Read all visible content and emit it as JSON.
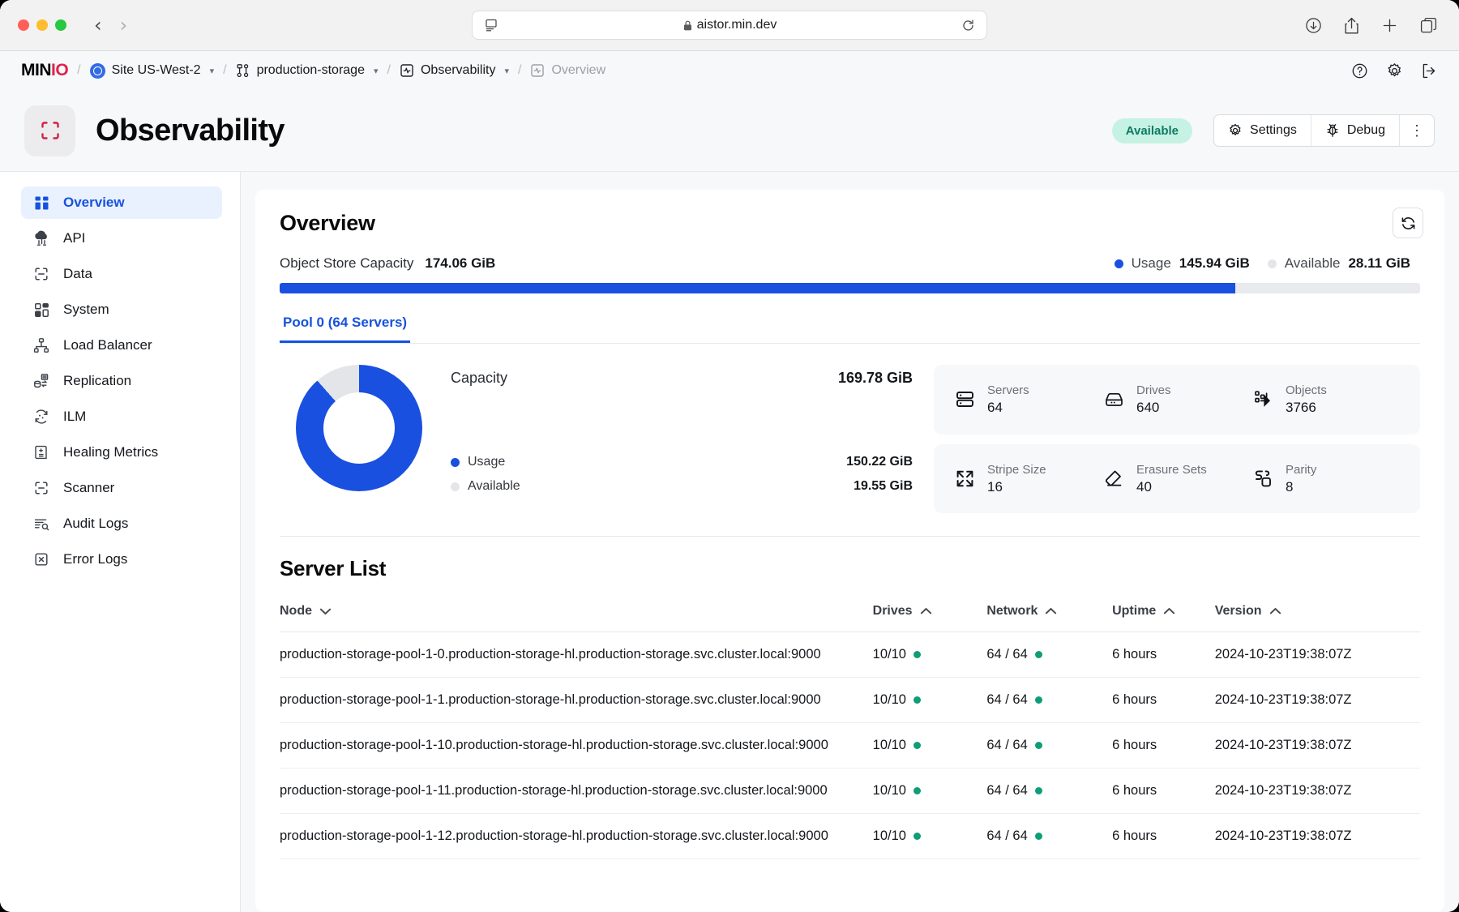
{
  "browser": {
    "url": "aistor.min.dev",
    "lock_icon": "lock-icon",
    "back_icon": "chevron-left-icon",
    "forward_icon": "chevron-right-icon",
    "sidebar_icon": "sidebar-toggle-icon",
    "reload_icon": "reload-icon",
    "downloads_icon": "downloads-icon",
    "share_icon": "share-icon",
    "newtab_icon": "plus-icon",
    "tabs_icon": "tab-overview-icon"
  },
  "topbar": {
    "logo_min": "MIN",
    "logo_io": "IO",
    "separator": "/",
    "breadcrumbs": [
      {
        "label": "Site US-West-2",
        "icon": "kubernetes-icon",
        "has_chevron": true,
        "dim": false
      },
      {
        "label": "production-storage",
        "icon": "tenant-icon",
        "has_chevron": true,
        "dim": false
      },
      {
        "label": "Observability",
        "icon": "observability-icon",
        "has_chevron": true,
        "dim": false
      },
      {
        "label": "Overview",
        "icon": "observability-icon",
        "has_chevron": false,
        "dim": true
      }
    ],
    "actions": [
      {
        "name": "help-icon"
      },
      {
        "name": "gear-icon"
      },
      {
        "name": "logout-icon"
      }
    ]
  },
  "header": {
    "icon": "scan-frame-icon",
    "title": "Observability",
    "status_badge": "Available",
    "settings_label": "Settings",
    "settings_icon": "gear-icon",
    "debug_label": "Debug",
    "debug_icon": "bug-icon",
    "kebab": "⋮"
  },
  "sidebar": {
    "items": [
      {
        "label": "Overview",
        "icon": "grid-icon",
        "active": true
      },
      {
        "label": "API",
        "icon": "cloud-api-icon",
        "active": false
      },
      {
        "label": "Data",
        "icon": "scan-minus-icon",
        "active": false
      },
      {
        "label": "System",
        "icon": "grid-icon",
        "active": false
      },
      {
        "label": "Load Balancer",
        "icon": "hierarchy-icon",
        "active": false
      },
      {
        "label": "Replication",
        "icon": "replication-icon",
        "active": false
      },
      {
        "label": "ILM",
        "icon": "lifecycle-icon",
        "active": false
      },
      {
        "label": "Healing Metrics",
        "icon": "healing-icon",
        "active": false
      },
      {
        "label": "Scanner",
        "icon": "scan-minus-icon",
        "active": false
      },
      {
        "label": "Audit Logs",
        "icon": "audit-log-icon",
        "active": false
      },
      {
        "label": "Error Logs",
        "icon": "error-log-icon",
        "active": false
      }
    ]
  },
  "overview": {
    "title": "Overview",
    "refresh_icon": "refresh-icon",
    "capacity_label": "Object Store Capacity",
    "capacity_value": "174.06 GiB",
    "legend": [
      {
        "name": "Usage",
        "value": "145.94 GiB",
        "color": "#1a50e0"
      },
      {
        "name": "Available",
        "value": "28.11 GiB",
        "color": "#e3e5e8"
      }
    ],
    "bar_fill_percent": 83.8,
    "tabs": [
      {
        "label": "Pool 0 (64 Servers)",
        "active": true
      }
    ],
    "pool": {
      "capacity_label": "Capacity",
      "capacity_value": "169.78 GiB",
      "usage_label": "Usage",
      "usage_value": "150.22 GiB",
      "available_label": "Available",
      "available_value": "19.55 GiB",
      "donut_usage_percent": 88.5
    },
    "stats": [
      [
        {
          "icon": "servers-icon",
          "label": "Servers",
          "value": "64"
        },
        {
          "icon": "drive-icon",
          "label": "Drives",
          "value": "640"
        },
        {
          "icon": "objects-icon",
          "label": "Objects",
          "value": "3766"
        }
      ],
      [
        {
          "icon": "stripe-size-icon",
          "label": "Stripe Size",
          "value": "16"
        },
        {
          "icon": "erasure-sets-icon",
          "label": "Erasure Sets",
          "value": "40"
        },
        {
          "icon": "parity-icon",
          "label": "Parity",
          "value": "8"
        }
      ]
    ]
  },
  "server_list": {
    "title": "Server List",
    "columns": [
      {
        "label": "Node",
        "sort": "down"
      },
      {
        "label": "Drives",
        "sort": "up"
      },
      {
        "label": "Network",
        "sort": "up"
      },
      {
        "label": "Uptime",
        "sort": "up"
      },
      {
        "label": "Version",
        "sort": "up"
      }
    ],
    "rows": [
      {
        "node": "production-storage-pool-1-0.production-storage-hl.production-storage.svc.cluster.local:9000",
        "drives": "10/10",
        "network": "64 / 64",
        "uptime": "6 hours",
        "version": "2024-10-23T19:38:07Z"
      },
      {
        "node": "production-storage-pool-1-1.production-storage-hl.production-storage.svc.cluster.local:9000",
        "drives": "10/10",
        "network": "64 / 64",
        "uptime": "6 hours",
        "version": "2024-10-23T19:38:07Z"
      },
      {
        "node": "production-storage-pool-1-10.production-storage-hl.production-storage.svc.cluster.local:9000",
        "drives": "10/10",
        "network": "64 / 64",
        "uptime": "6 hours",
        "version": "2024-10-23T19:38:07Z"
      },
      {
        "node": "production-storage-pool-1-11.production-storage-hl.production-storage.svc.cluster.local:9000",
        "drives": "10/10",
        "network": "64 / 64",
        "uptime": "6 hours",
        "version": "2024-10-23T19:38:07Z"
      },
      {
        "node": "production-storage-pool-1-12.production-storage-hl.production-storage.svc.cluster.local:9000",
        "drives": "10/10",
        "network": "64 / 64",
        "uptime": "6 hours",
        "version": "2024-10-23T19:38:07Z"
      }
    ]
  },
  "colors": {
    "accent_blue": "#1a50e0",
    "link_blue": "#1652de",
    "status_green": "#0f9d77",
    "badge_bg": "#c6f2e3",
    "track_grey": "#e3e5e8",
    "minio_red": "#c51a30"
  }
}
